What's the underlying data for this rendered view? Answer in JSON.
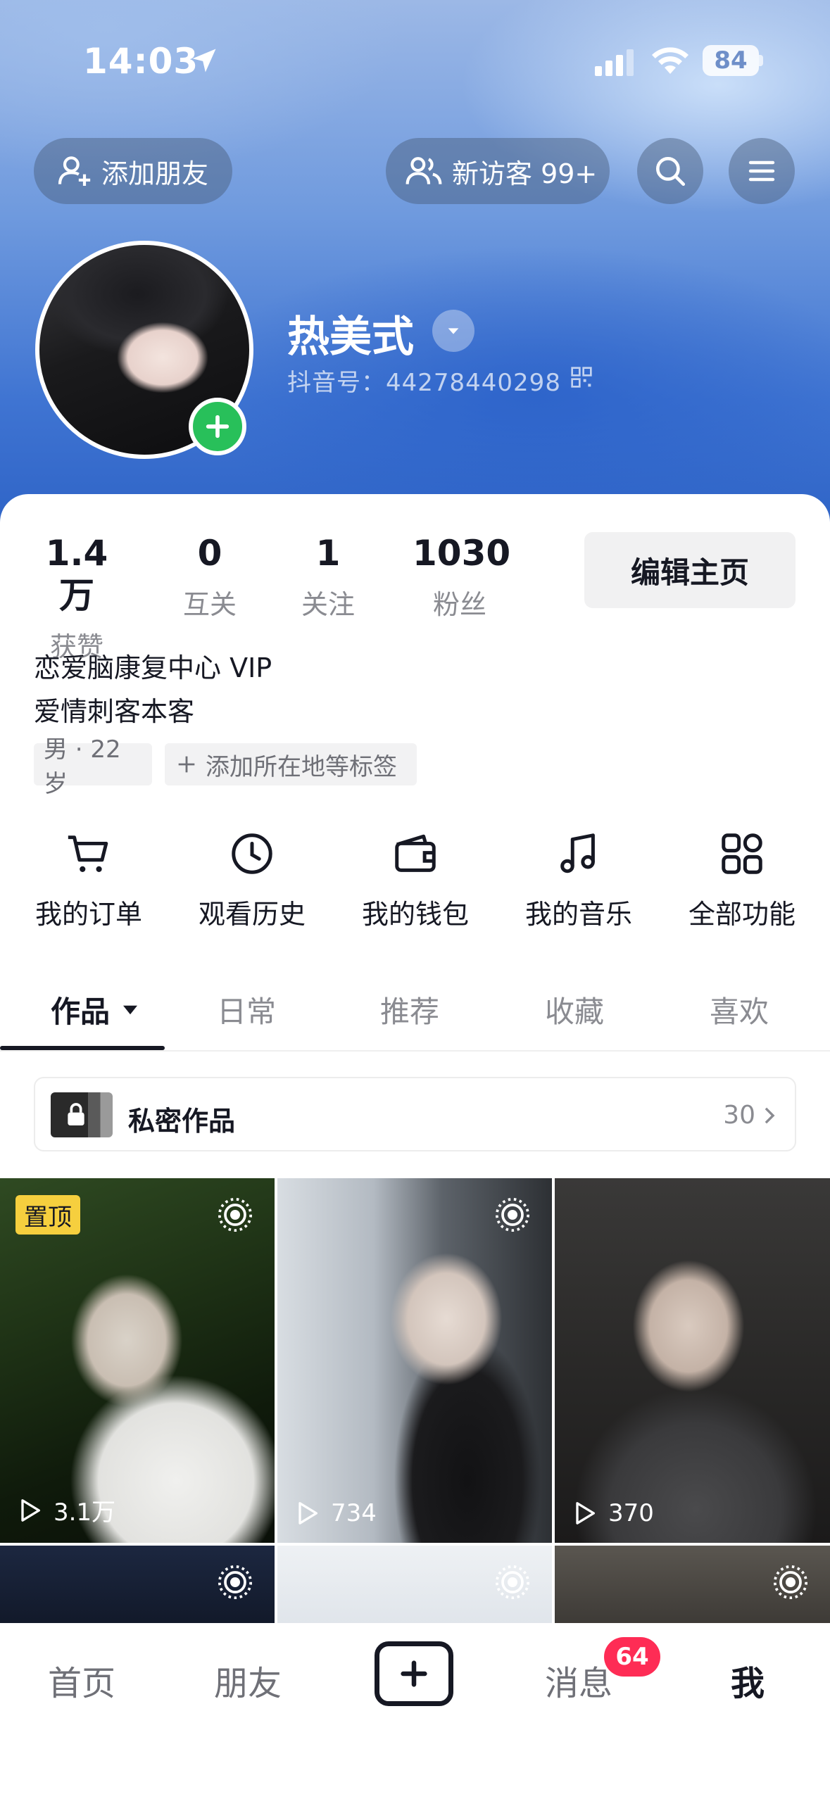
{
  "status_bar": {
    "time": "14:03",
    "battery": "84"
  },
  "header": {
    "add_friend": "添加朋友",
    "visitors": "新访客 99+"
  },
  "profile": {
    "name": "热美式",
    "douyin_id": "抖音号：44278440298"
  },
  "stats": [
    {
      "num": "1.4万",
      "label": "获赞"
    },
    {
      "num": "0",
      "label": "互关"
    },
    {
      "num": "1",
      "label": "关注"
    },
    {
      "num": "1030",
      "label": "粉丝"
    }
  ],
  "edit_profile": "编辑主页",
  "bio": [
    "恋爱脑康复中心 VIP",
    "爱情刺客本客"
  ],
  "tags": {
    "gender_age": "男 · 22 岁",
    "add_tags": "添加所在地等标签"
  },
  "functions": [
    {
      "label": "我的订单",
      "icon": "cart-icon"
    },
    {
      "label": "观看历史",
      "icon": "clock-icon"
    },
    {
      "label": "我的钱包",
      "icon": "wallet-icon"
    },
    {
      "label": "我的音乐",
      "icon": "music-icon"
    },
    {
      "label": "全部功能",
      "icon": "grid-icon"
    }
  ],
  "tabs": [
    "作品",
    "日常",
    "推荐",
    "收藏",
    "喜欢"
  ],
  "private_works": {
    "label": "私密作品",
    "count": "30"
  },
  "videos": [
    {
      "pinned": "置顶",
      "views": "3.1万"
    },
    {
      "views": "734"
    },
    {
      "views": "370"
    }
  ],
  "bottom_nav": {
    "home": "首页",
    "friends": "朋友",
    "messages": "消息",
    "messages_badge": "64",
    "me": "我"
  },
  "colors": {
    "accent": "#fe2c55",
    "add_green": "#28c05a",
    "pin_yellow": "#f6cf3e"
  }
}
